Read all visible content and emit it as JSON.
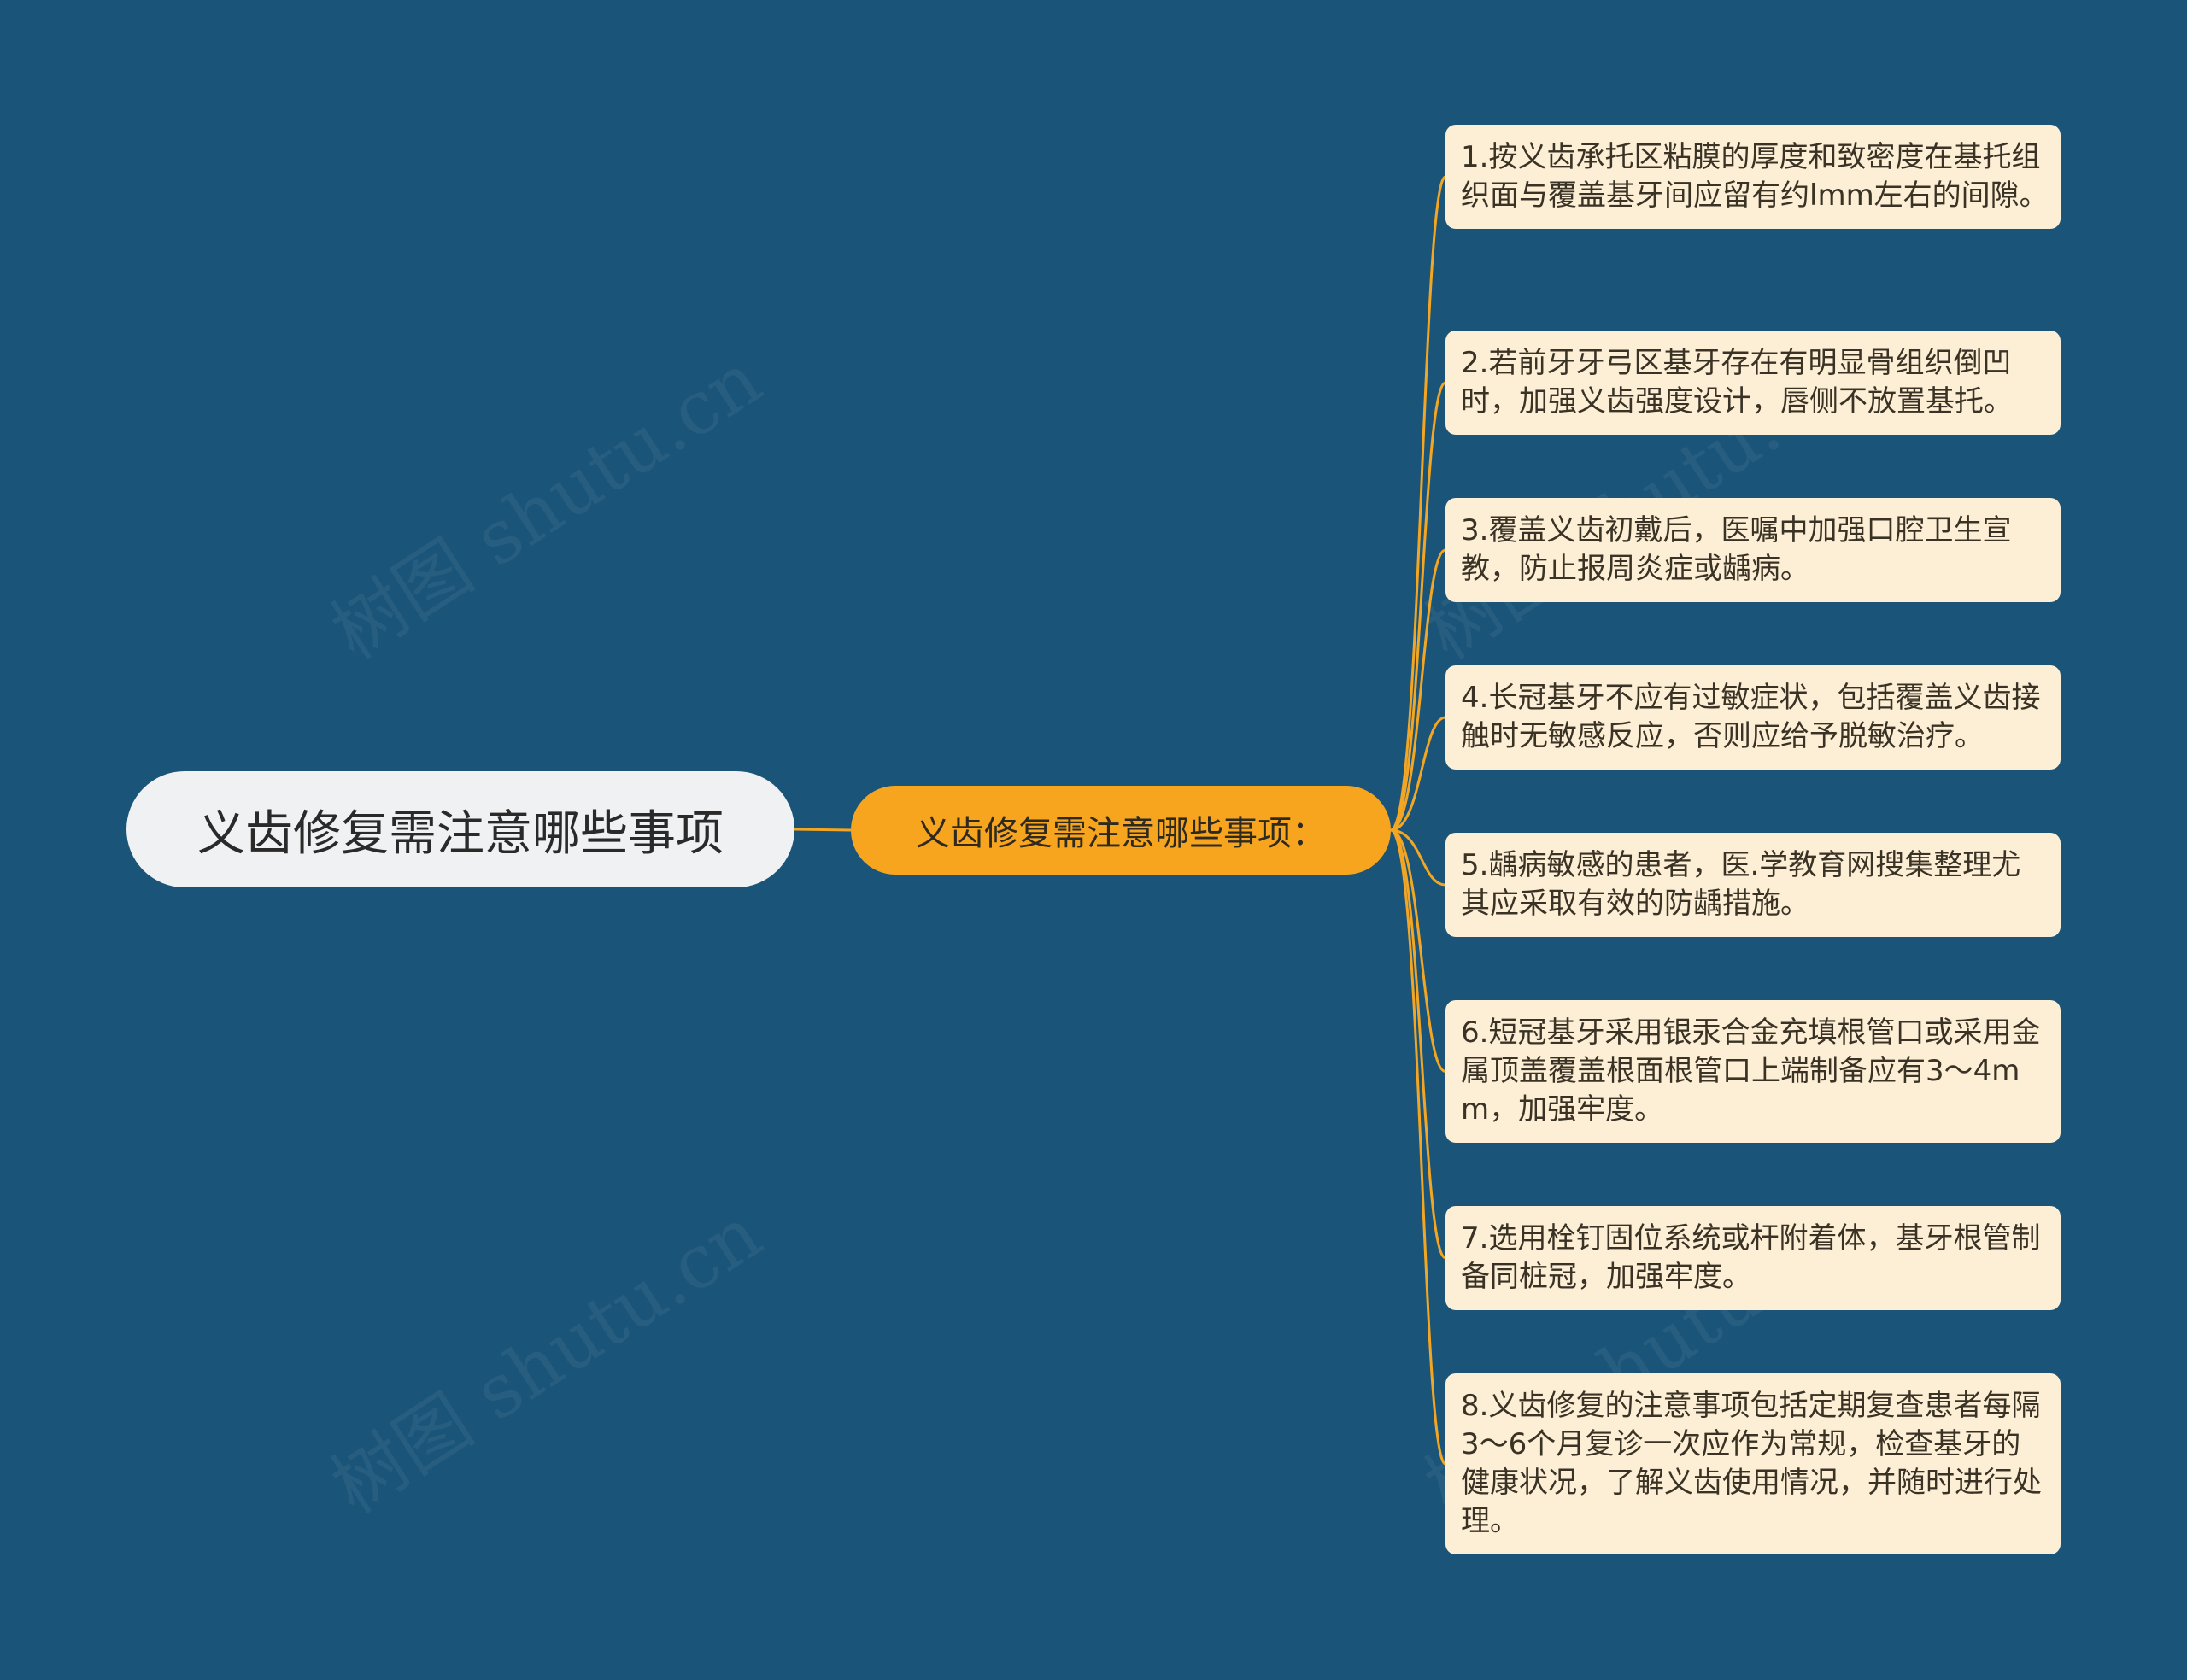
{
  "colors": {
    "background": "#1a5479",
    "root_fill": "#f0f1f3",
    "sub_fill": "#f7a51f",
    "leaf_fill": "#fdefd6",
    "connector": "#f2a623"
  },
  "watermark_text": "树图 shutu.cn",
  "root": {
    "label": "义齿修复需注意哪些事项"
  },
  "subtopic": {
    "label": "义齿修复需注意哪些事项："
  },
  "leaves": [
    {
      "text": "1.按义齿承托区粘膜的厚度和致密度在基托组织面与覆盖基牙间应留有约lmm左右的间隙。"
    },
    {
      "text": "2.若前牙牙弓区基牙存在有明显骨组织倒凹时，加强义齿强度设计，唇侧不放置基托。"
    },
    {
      "text": "3.覆盖义齿初戴后，医嘱中加强口腔卫生宣教，防止报周炎症或龋病。"
    },
    {
      "text": "4.长冠基牙不应有过敏症状，包括覆盖义齿接触时无敏感反应，否则应给予脱敏治疗。"
    },
    {
      "text": "5.龋病敏感的患者，医.学教育网搜集整理尤其应采取有效的防龋措施。"
    },
    {
      "text": "6.短冠基牙采用银汞合金充填根管口或采用金属顶盖覆盖根面根管口上端制备应有3～4mm，加强牢度。"
    },
    {
      "text": "7.选用栓钉固位系统或杆附着体，基牙根管制备同桩冠，加强牢度。"
    },
    {
      "text": "8.义齿修复的注意事项包括定期复查患者每隔3～6个月复诊一次应作为常规，检查基牙的健康状况，了解义齿使用情况，并随时进行处理。"
    }
  ]
}
